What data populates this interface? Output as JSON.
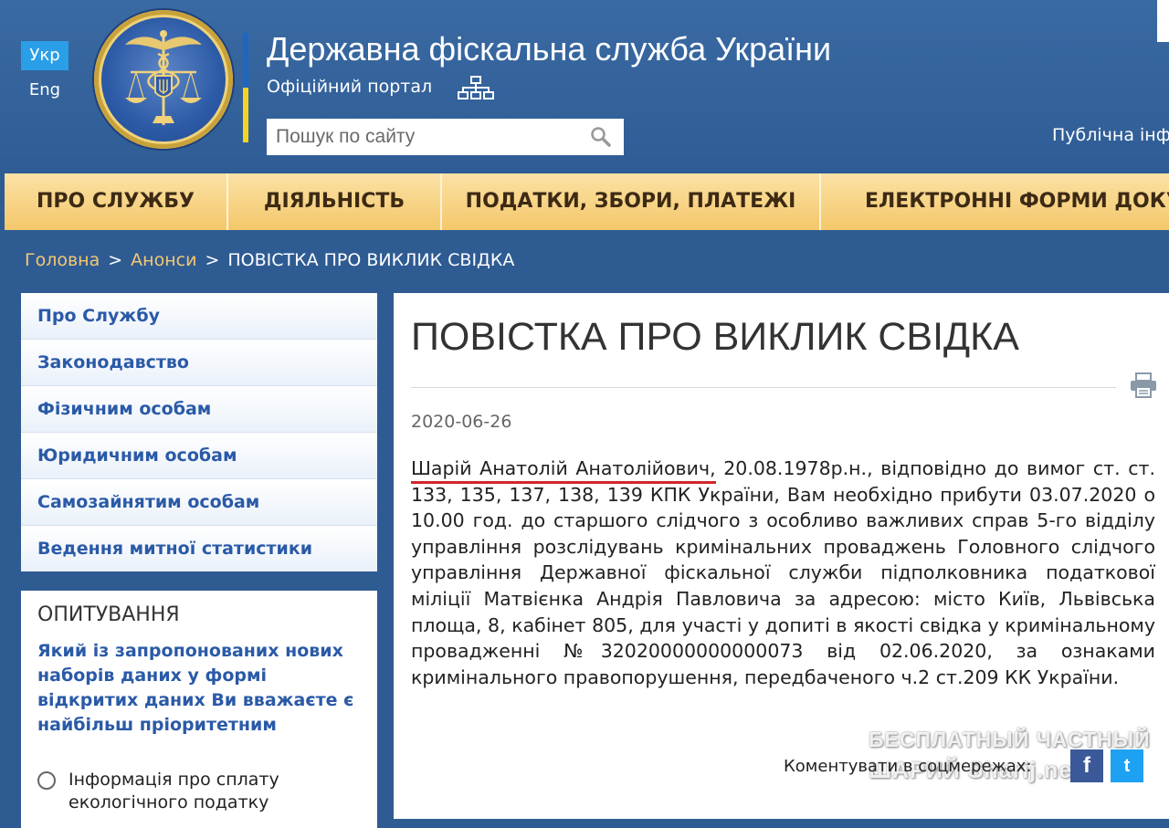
{
  "lang": {
    "current": "Укр",
    "other": "Eng"
  },
  "header": {
    "title": "Державна фіскальна служба України",
    "subtitle": "Офіційний портал",
    "search_placeholder": "Пошук по сайту",
    "public_link": "Публічна інф"
  },
  "nav": [
    {
      "label": "ПРО СЛУЖБУ"
    },
    {
      "label": "ДІЯЛЬНІСТЬ"
    },
    {
      "label": "ПОДАТКИ, ЗБОРИ, ПЛАТЕЖІ"
    },
    {
      "label": "ЕЛЕКТРОННІ ФОРМИ ДОКУМ"
    }
  ],
  "breadcrumb": {
    "home": "Головна",
    "section": "Анонси",
    "current": "ПОВІСТКА ПРО ВИКЛИК СВІДКА",
    "separator": ">"
  },
  "sidebar": {
    "items": [
      {
        "label": "Про Службу"
      },
      {
        "label": "Законодавство"
      },
      {
        "label": "Фізичним особам"
      },
      {
        "label": "Юридичним особам"
      },
      {
        "label": "Самозайнятим особам"
      },
      {
        "label": "Ведення митної статистики"
      }
    ]
  },
  "poll": {
    "title": "ОПИТУВАННЯ",
    "question": "Який  із запропонованих нових наборів даних у формі відкритих даних Ви вважаєте є найбільш пріоритетним",
    "option1": "Інформація про сплату екологічного податку"
  },
  "article": {
    "title": "ПОВІСТКА ПРО ВИКЛИК СВІДКА",
    "date": "2020-06-26",
    "name": "Шарій Анатолій Анатолійович,",
    "body": " 20.08.1978р.н., відповідно до вимог ст. ст. 133, 135, 137, 138, 139 КПК України, Вам необхідно прибути 03.07.2020 о 10.00 год. до старшого слідчого з особливо важливих справ 5-го відділу управління розслідувань кримінальних проваджень Головного слідчого управління Державної фіскальної служби підполковника податкової міліції  Матвієнка Андрія Павловича за адресою: місто Київ, Львівська площа, 8, кабінет 805, для участі у допиті в якості свідка у кримінальному провадженні №32020000000000073 від 02.06.2020, за ознаками кримінального правопорушення, передбаченого ч.2 ст.209 КК України.",
    "comment_label": "Коментувати в соцмережах:",
    "fb": "f",
    "tw": "t"
  },
  "watermark": {
    "line1": "БЕСПЛАТНЫЙ ЧАСТНЫЙ",
    "line2": "ШАРИЙ Sharij.net"
  },
  "colors": {
    "header_blue": "#2f5b93",
    "nav_gold": "#f4c76a",
    "link_blue": "#2a5aa7",
    "crumb_gold": "#f4c870",
    "underline_red": "#d0262b"
  }
}
